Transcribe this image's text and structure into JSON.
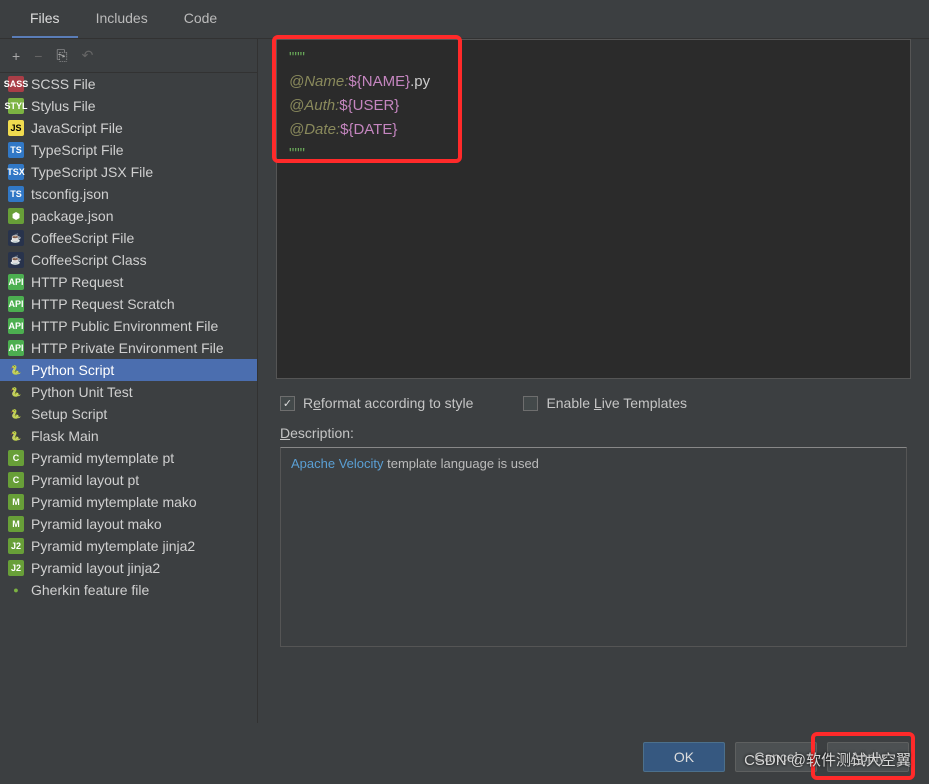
{
  "tabs": [
    {
      "label": "Files",
      "active": true
    },
    {
      "label": "Includes",
      "active": false
    },
    {
      "label": "Code",
      "active": false
    }
  ],
  "toolbar": {
    "add": "+",
    "remove": "−",
    "copy": "⎘",
    "undo": "↶"
  },
  "files": [
    {
      "label": "SCSS File",
      "icon": "SASS",
      "bg": "#aa3e47",
      "fg": "#fff"
    },
    {
      "label": "Stylus File",
      "icon": "STYL",
      "bg": "#7cb342",
      "fg": "#fff"
    },
    {
      "label": "JavaScript File",
      "icon": "JS",
      "bg": "#f0db4f",
      "fg": "#000"
    },
    {
      "label": "TypeScript File",
      "icon": "TS",
      "bg": "#3178c6",
      "fg": "#fff"
    },
    {
      "label": "TypeScript JSX File",
      "icon": "TSX",
      "bg": "#3178c6",
      "fg": "#fff"
    },
    {
      "label": "tsconfig.json",
      "icon": "TS",
      "bg": "#3178c6",
      "fg": "#fff"
    },
    {
      "label": "package.json",
      "icon": "⬢",
      "bg": "#689f38",
      "fg": "#fff"
    },
    {
      "label": "CoffeeScript File",
      "icon": "☕",
      "bg": "#28334c",
      "fg": "#fff"
    },
    {
      "label": "CoffeeScript Class",
      "icon": "☕",
      "bg": "#28334c",
      "fg": "#fff"
    },
    {
      "label": "HTTP Request",
      "icon": "API",
      "bg": "#4caf50",
      "fg": "#fff"
    },
    {
      "label": "HTTP Request Scratch",
      "icon": "API",
      "bg": "#4caf50",
      "fg": "#fff"
    },
    {
      "label": "HTTP Public Environment File",
      "icon": "API",
      "bg": "#4caf50",
      "fg": "#fff"
    },
    {
      "label": "HTTP Private Environment File",
      "icon": "API",
      "bg": "#4caf50",
      "fg": "#fff"
    },
    {
      "label": "Python Script",
      "icon": "🐍",
      "bg": "",
      "fg": "",
      "selected": true
    },
    {
      "label": "Python Unit Test",
      "icon": "🐍",
      "bg": "",
      "fg": ""
    },
    {
      "label": "Setup Script",
      "icon": "🐍",
      "bg": "",
      "fg": ""
    },
    {
      "label": "Flask Main",
      "icon": "🐍",
      "bg": "",
      "fg": ""
    },
    {
      "label": "Pyramid mytemplate pt",
      "icon": "C",
      "bg": "#689f38",
      "fg": "#fff"
    },
    {
      "label": "Pyramid layout pt",
      "icon": "C",
      "bg": "#689f38",
      "fg": "#fff"
    },
    {
      "label": "Pyramid mytemplate mako",
      "icon": "M",
      "bg": "#689f38",
      "fg": "#fff"
    },
    {
      "label": "Pyramid layout mako",
      "icon": "M",
      "bg": "#689f38",
      "fg": "#fff"
    },
    {
      "label": "Pyramid mytemplate jinja2",
      "icon": "J2",
      "bg": "#689f38",
      "fg": "#fff"
    },
    {
      "label": "Pyramid layout jinja2",
      "icon": "J2",
      "bg": "#689f38",
      "fg": "#fff"
    },
    {
      "label": "Gherkin feature file",
      "icon": "●",
      "bg": "",
      "fg": "#7cb342"
    }
  ],
  "editor": {
    "line1": "\"\"\"",
    "line2a": "@Name:",
    "line2b": "${NAME}",
    "line2c": ".py",
    "line3a": "@Auth:",
    "line3b": "${USER}",
    "line4a": "@Date:",
    "line4b": "${DATE}",
    "line5": "\"\"\""
  },
  "checks": {
    "reformat_label_pre": "R",
    "reformat_label_u": "e",
    "reformat_label_post": "format according to style",
    "reformat_checked": true,
    "live_label_pre": "Enable ",
    "live_label_u": "L",
    "live_label_post": "ive Templates",
    "live_checked": false
  },
  "description": {
    "label_pre": "",
    "label_u": "D",
    "label_post": "escription:",
    "link_text": "Apache Velocity",
    "rest": " template language is used"
  },
  "buttons": {
    "ok": "OK",
    "cancel": "Cancel",
    "apply_pre": "",
    "apply_u": "A",
    "apply_post": "pply"
  },
  "watermark": "CSDN @软件测试大空翼"
}
